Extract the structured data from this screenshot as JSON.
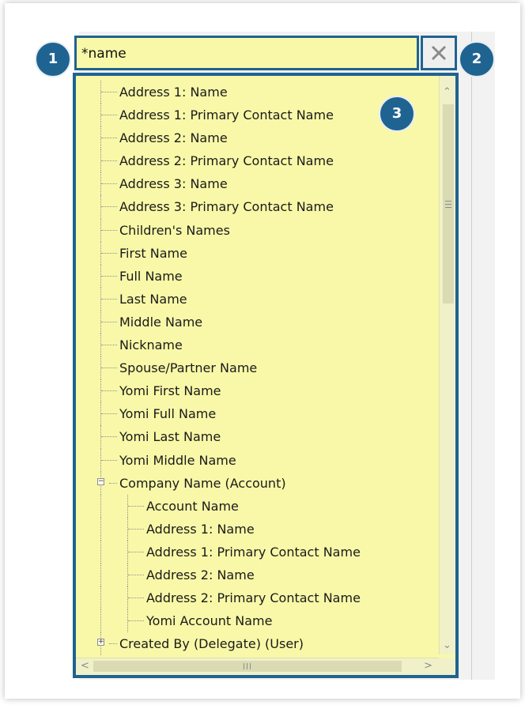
{
  "search": {
    "value": "*name",
    "clear_icon": "close-icon"
  },
  "tree": {
    "items": [
      {
        "label": "Address 1: Name",
        "level": 0
      },
      {
        "label": "Address 1: Primary Contact Name",
        "level": 0
      },
      {
        "label": "Address 2: Name",
        "level": 0
      },
      {
        "label": "Address 2: Primary Contact Name",
        "level": 0
      },
      {
        "label": "Address 3: Name",
        "level": 0
      },
      {
        "label": "Address 3: Primary Contact Name",
        "level": 0
      },
      {
        "label": "Children's Names",
        "level": 0
      },
      {
        "label": "First Name",
        "level": 0
      },
      {
        "label": "Full Name",
        "level": 0
      },
      {
        "label": "Last Name",
        "level": 0
      },
      {
        "label": "Middle Name",
        "level": 0
      },
      {
        "label": "Nickname",
        "level": 0
      },
      {
        "label": "Spouse/Partner Name",
        "level": 0
      },
      {
        "label": "Yomi First Name",
        "level": 0
      },
      {
        "label": "Yomi Full Name",
        "level": 0
      },
      {
        "label": "Yomi Last Name",
        "level": 0
      },
      {
        "label": "Yomi Middle Name",
        "level": 0
      },
      {
        "label": "Company Name (Account)",
        "level": 0,
        "toggle": "collapse"
      },
      {
        "label": "Account Name",
        "level": 1
      },
      {
        "label": "Address 1: Name",
        "level": 1
      },
      {
        "label": "Address 1: Primary Contact Name",
        "level": 1
      },
      {
        "label": "Address 2: Name",
        "level": 1
      },
      {
        "label": "Address 2: Primary Contact Name",
        "level": 1
      },
      {
        "label": "Yomi Account Name",
        "level": 1
      },
      {
        "label": "Created By (Delegate) (User)",
        "level": 0,
        "toggle": "expand"
      }
    ]
  },
  "callouts": [
    "1",
    "2",
    "3"
  ],
  "colors": {
    "highlight_yellow": "#f8f8a8",
    "callout_blue": "#1f6391"
  }
}
